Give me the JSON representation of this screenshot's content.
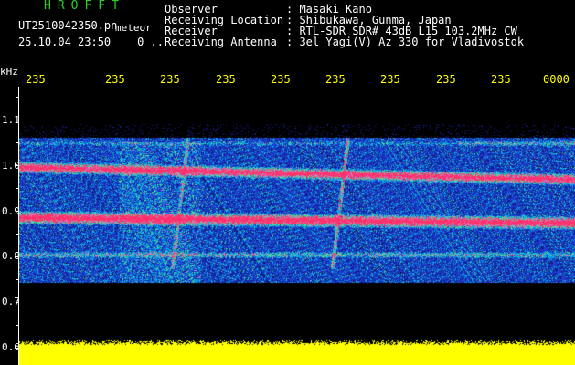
{
  "header": {
    "app_title": "HROFFT",
    "file_name": "UT2510042350.pn",
    "mode": "meteor",
    "timestamp": "25.10.04 23:50",
    "timestamp_extra": "0 ..",
    "info": [
      {
        "label": "Observer",
        "value": ": Masaki Kano"
      },
      {
        "label": "Receiving Location",
        "value": ": Shibukawa, Gunma, Japan"
      },
      {
        "label": "Receiver",
        "value": ": RTL-SDR SDR# 43dB L15 103.2MHz CW"
      },
      {
        "label": "Receiving Antenna",
        "value": ": 3el Yagi(V) Az 330 for Vladivostok"
      }
    ]
  },
  "spectrogram": {
    "unit": "kHz",
    "top_ticks": [
      "235",
      "235",
      "235",
      "235",
      "235",
      "235",
      "235",
      "235",
      "235",
      "0000"
    ],
    "y_ticks": [
      "1.1",
      "1.0",
      "0.9",
      "0.8",
      "0.7",
      "0.6"
    ],
    "colors": {
      "background": "#000000",
      "signal_low": "#1a2aa8",
      "signal_mid": "#00c8ff",
      "signal_high": "#ff3070",
      "noise_bar": "#ffff00"
    }
  }
}
